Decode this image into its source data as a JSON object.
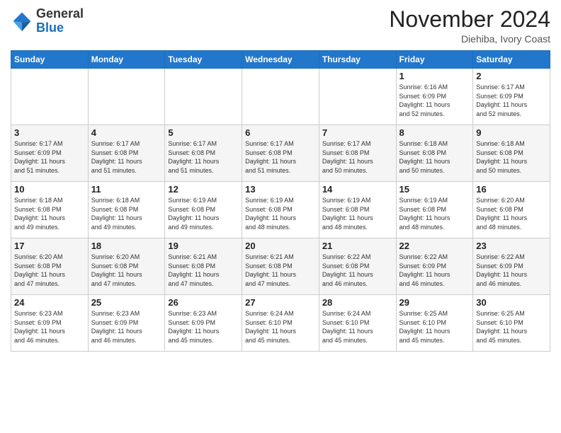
{
  "logo": {
    "general": "General",
    "blue": "Blue"
  },
  "header": {
    "month": "November 2024",
    "location": "Diehiba, Ivory Coast"
  },
  "weekdays": [
    "Sunday",
    "Monday",
    "Tuesday",
    "Wednesday",
    "Thursday",
    "Friday",
    "Saturday"
  ],
  "weeks": [
    [
      {
        "day": "",
        "info": ""
      },
      {
        "day": "",
        "info": ""
      },
      {
        "day": "",
        "info": ""
      },
      {
        "day": "",
        "info": ""
      },
      {
        "day": "",
        "info": ""
      },
      {
        "day": "1",
        "info": "Sunrise: 6:16 AM\nSunset: 6:09 PM\nDaylight: 11 hours\nand 52 minutes."
      },
      {
        "day": "2",
        "info": "Sunrise: 6:17 AM\nSunset: 6:09 PM\nDaylight: 11 hours\nand 52 minutes."
      }
    ],
    [
      {
        "day": "3",
        "info": "Sunrise: 6:17 AM\nSunset: 6:09 PM\nDaylight: 11 hours\nand 51 minutes."
      },
      {
        "day": "4",
        "info": "Sunrise: 6:17 AM\nSunset: 6:08 PM\nDaylight: 11 hours\nand 51 minutes."
      },
      {
        "day": "5",
        "info": "Sunrise: 6:17 AM\nSunset: 6:08 PM\nDaylight: 11 hours\nand 51 minutes."
      },
      {
        "day": "6",
        "info": "Sunrise: 6:17 AM\nSunset: 6:08 PM\nDaylight: 11 hours\nand 51 minutes."
      },
      {
        "day": "7",
        "info": "Sunrise: 6:17 AM\nSunset: 6:08 PM\nDaylight: 11 hours\nand 50 minutes."
      },
      {
        "day": "8",
        "info": "Sunrise: 6:18 AM\nSunset: 6:08 PM\nDaylight: 11 hours\nand 50 minutes."
      },
      {
        "day": "9",
        "info": "Sunrise: 6:18 AM\nSunset: 6:08 PM\nDaylight: 11 hours\nand 50 minutes."
      }
    ],
    [
      {
        "day": "10",
        "info": "Sunrise: 6:18 AM\nSunset: 6:08 PM\nDaylight: 11 hours\nand 49 minutes."
      },
      {
        "day": "11",
        "info": "Sunrise: 6:18 AM\nSunset: 6:08 PM\nDaylight: 11 hours\nand 49 minutes."
      },
      {
        "day": "12",
        "info": "Sunrise: 6:19 AM\nSunset: 6:08 PM\nDaylight: 11 hours\nand 49 minutes."
      },
      {
        "day": "13",
        "info": "Sunrise: 6:19 AM\nSunset: 6:08 PM\nDaylight: 11 hours\nand 48 minutes."
      },
      {
        "day": "14",
        "info": "Sunrise: 6:19 AM\nSunset: 6:08 PM\nDaylight: 11 hours\nand 48 minutes."
      },
      {
        "day": "15",
        "info": "Sunrise: 6:19 AM\nSunset: 6:08 PM\nDaylight: 11 hours\nand 48 minutes."
      },
      {
        "day": "16",
        "info": "Sunrise: 6:20 AM\nSunset: 6:08 PM\nDaylight: 11 hours\nand 48 minutes."
      }
    ],
    [
      {
        "day": "17",
        "info": "Sunrise: 6:20 AM\nSunset: 6:08 PM\nDaylight: 11 hours\nand 47 minutes."
      },
      {
        "day": "18",
        "info": "Sunrise: 6:20 AM\nSunset: 6:08 PM\nDaylight: 11 hours\nand 47 minutes."
      },
      {
        "day": "19",
        "info": "Sunrise: 6:21 AM\nSunset: 6:08 PM\nDaylight: 11 hours\nand 47 minutes."
      },
      {
        "day": "20",
        "info": "Sunrise: 6:21 AM\nSunset: 6:08 PM\nDaylight: 11 hours\nand 47 minutes."
      },
      {
        "day": "21",
        "info": "Sunrise: 6:22 AM\nSunset: 6:08 PM\nDaylight: 11 hours\nand 46 minutes."
      },
      {
        "day": "22",
        "info": "Sunrise: 6:22 AM\nSunset: 6:09 PM\nDaylight: 11 hours\nand 46 minutes."
      },
      {
        "day": "23",
        "info": "Sunrise: 6:22 AM\nSunset: 6:09 PM\nDaylight: 11 hours\nand 46 minutes."
      }
    ],
    [
      {
        "day": "24",
        "info": "Sunrise: 6:23 AM\nSunset: 6:09 PM\nDaylight: 11 hours\nand 46 minutes."
      },
      {
        "day": "25",
        "info": "Sunrise: 6:23 AM\nSunset: 6:09 PM\nDaylight: 11 hours\nand 46 minutes."
      },
      {
        "day": "26",
        "info": "Sunrise: 6:23 AM\nSunset: 6:09 PM\nDaylight: 11 hours\nand 45 minutes."
      },
      {
        "day": "27",
        "info": "Sunrise: 6:24 AM\nSunset: 6:10 PM\nDaylight: 11 hours\nand 45 minutes."
      },
      {
        "day": "28",
        "info": "Sunrise: 6:24 AM\nSunset: 6:10 PM\nDaylight: 11 hours\nand 45 minutes."
      },
      {
        "day": "29",
        "info": "Sunrise: 6:25 AM\nSunset: 6:10 PM\nDaylight: 11 hours\nand 45 minutes."
      },
      {
        "day": "30",
        "info": "Sunrise: 6:25 AM\nSunset: 6:10 PM\nDaylight: 11 hours\nand 45 minutes."
      }
    ]
  ]
}
